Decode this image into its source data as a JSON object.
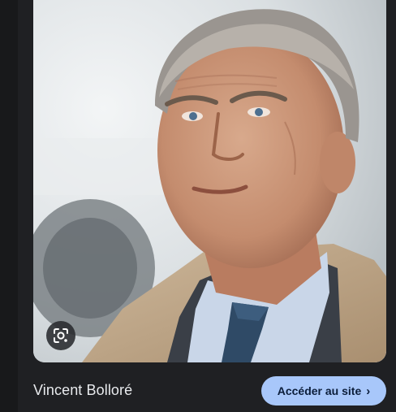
{
  "result": {
    "title": "Vincent Bolloré",
    "visit_label": "Accéder au site",
    "visit_icon": "chevron-right-icon",
    "visit_icon_glyph": "›",
    "lens_icon": "lens-search-icon"
  },
  "colors": {
    "background": "#1f2023",
    "button": "#a8c7fa",
    "title_text": "#e8eaed"
  }
}
